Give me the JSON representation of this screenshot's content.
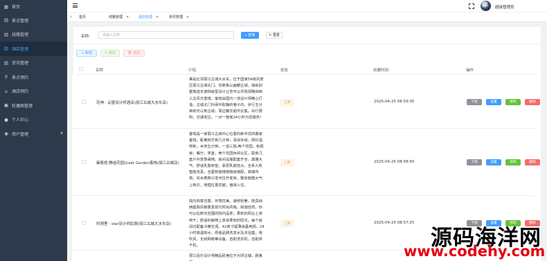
{
  "sidebar": {
    "items": [
      {
        "label": "首页",
        "icon": "dashboard-icon"
      },
      {
        "label": "景点管理",
        "icon": "document-icon"
      },
      {
        "label": "线路管理",
        "icon": "document-icon"
      },
      {
        "label": "酒店管理",
        "icon": "document-icon"
      },
      {
        "label": "资讯管理",
        "icon": "document-icon"
      },
      {
        "label": "景点预约",
        "icon": "pin-icon"
      },
      {
        "label": "酒店预约",
        "icon": "hotel-icon"
      },
      {
        "label": "轮播图管理",
        "icon": "image-icon"
      },
      {
        "label": "个人中心",
        "icon": "user-icon"
      },
      {
        "label": "用户管理",
        "icon": "users-icon"
      }
    ],
    "active_index": 3
  },
  "header": {
    "username": "超级管理员"
  },
  "tags": [
    {
      "label": "首页",
      "closable": false
    },
    {
      "label": "线路管理",
      "closable": true
    },
    {
      "label": "酒店管理",
      "closable": true
    },
    {
      "label": "资讯管理",
      "closable": true
    }
  ],
  "search": {
    "label": "名称:",
    "placeholder": "请输入名称",
    "value": "",
    "query_label": "查询",
    "reset_label": "重置"
  },
  "toolbar": {
    "add_label": "+ 新增",
    "edit_label": "修改",
    "delete_label": "删除"
  },
  "table": {
    "columns": [
      "名称",
      "介绍",
      "状态",
      "创建时间",
      "操作"
    ],
    "rows": [
      {
        "name": "花神 · 云璧设计师酒店(丽江古城大水车店)",
        "intro": "秉是比邻丽江古城大水车，位于国家5A级风景区丽江古城北门。背靠象山面朝古城，独栋别墅搞选无遮挡房型设计让您可以尽情领略纳西人文风光意境。客栈由国内一流设计师精心打造，古城北门外闹中取静的巷子内，步行五分钟就可以到古城，周边餐饮超市云集。出行便利，交通发达。一对一管家24小时为您服务!",
        "status": "上架",
        "created": "2025-04-25 08:59:35"
      },
      {
        "name": "雍客居·静谧花园Quiet Garden客栈(丽江古城店)",
        "intro": "客栈是一家丽江古城中心位置的新中式四鼎家客栈。距离四方街几分钟，清凉米线，网红酒吧街，木府五分钟。一进三院,两个花园，有厨房，餐厅，茶室，两个花园休闲公区，配有几套户外赏景桌椅。房间设施配套齐全，典雅大气，舒适乳胶床垫，豪思乳胶枕头，全系九牧智能洗具，全屋软装博物馆级搭配，高端布草。实木榫榫沙发可拉开变床，整体典雅大气上档次，地理位置优越，值得入住。",
        "status": "上架",
        "created": "2025-04-25 08:58:50"
      },
      {
        "name": "时洞里 · star设计师民宿(丽江古城大水车店)",
        "intro": "院内四季花香。环境优美。装修轻奢，既具纳西庭院风格更具现代时尚风格，和谐自然。你可以在鲜花包围的院内品茶；柔软的阳台上亲吻干；舒适的躺椅上享受柔软的阳光。每个房间均配备冷暖空调。42英寸超薄液晶电视，24小时高温热水，原装品牌洗发水及沐浴露，电吹风，无线网络等设备。自助洗衣机，自助烘干机。",
        "status": "上架",
        "created": "2025-04-25 08:57:25"
      },
      {
        "name": "",
        "intro": "丽江后乐设计师精品民宿位于大研古镇，距离古",
        "status": "",
        "created": ""
      }
    ],
    "op_labels": {
      "down": "下架",
      "setting": "设置",
      "edit": "修改",
      "delete": "删除"
    }
  },
  "watermark": {
    "cn": "源码海洋网",
    "url": "www.codehy.com"
  },
  "colors": {
    "sidebar_bg": "#2d3a4b",
    "sidebar_active": "#409eff",
    "primary": "#409eff",
    "success": "#67c23a",
    "danger": "#f56c6c",
    "info": "#909399",
    "warning": "#e6a23c"
  }
}
